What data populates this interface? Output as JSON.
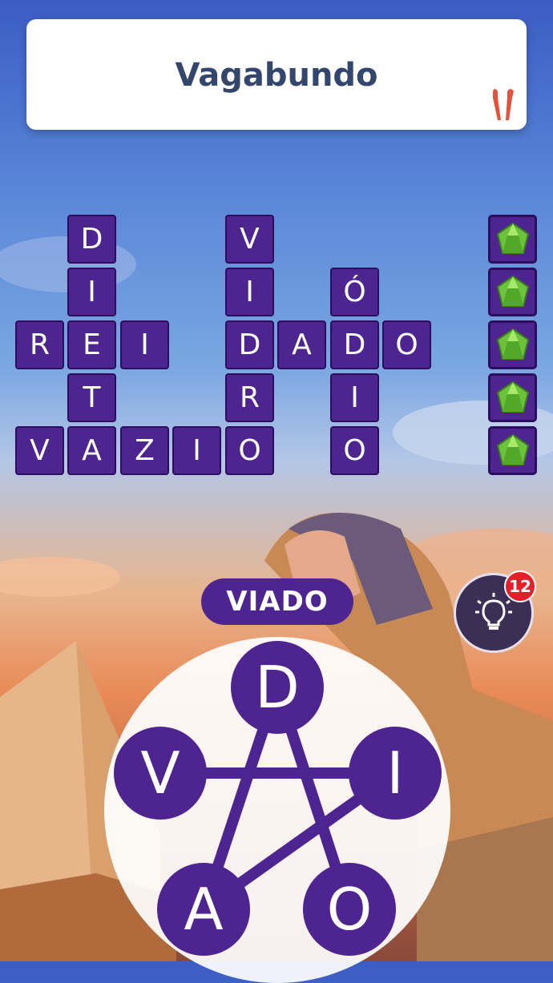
{
  "clue": {
    "word": "Vagabundo"
  },
  "grid": {
    "letters": {
      "d1": "D",
      "i1": "I",
      "r1": "R",
      "e1": "E",
      "i2": "I",
      "t1": "T",
      "v1": "V",
      "a1": "A",
      "z1": "Z",
      "i3": "I",
      "o1": "O",
      "v2": "V",
      "i4": "I",
      "d2": "D",
      "r2": "R",
      "a2": "A",
      "d3": "D",
      "o2": "O",
      "o3": "Ó",
      "i5": "I",
      "o4": "O"
    }
  },
  "bonus_gems": {
    "count": 5,
    "icon": "green-gem-icon"
  },
  "current_word": "VIADO",
  "hint": {
    "count": "12",
    "icon": "lightbulb-icon"
  },
  "wheel": {
    "letters": {
      "top": "D",
      "left": "V",
      "right": "I",
      "bottom_left": "A",
      "bottom_right": "O"
    }
  },
  "colors": {
    "tile": "#4e2590",
    "tile_border": "#2c0e5e",
    "clue_text": "#33466d",
    "badge": "#e51f2a"
  }
}
